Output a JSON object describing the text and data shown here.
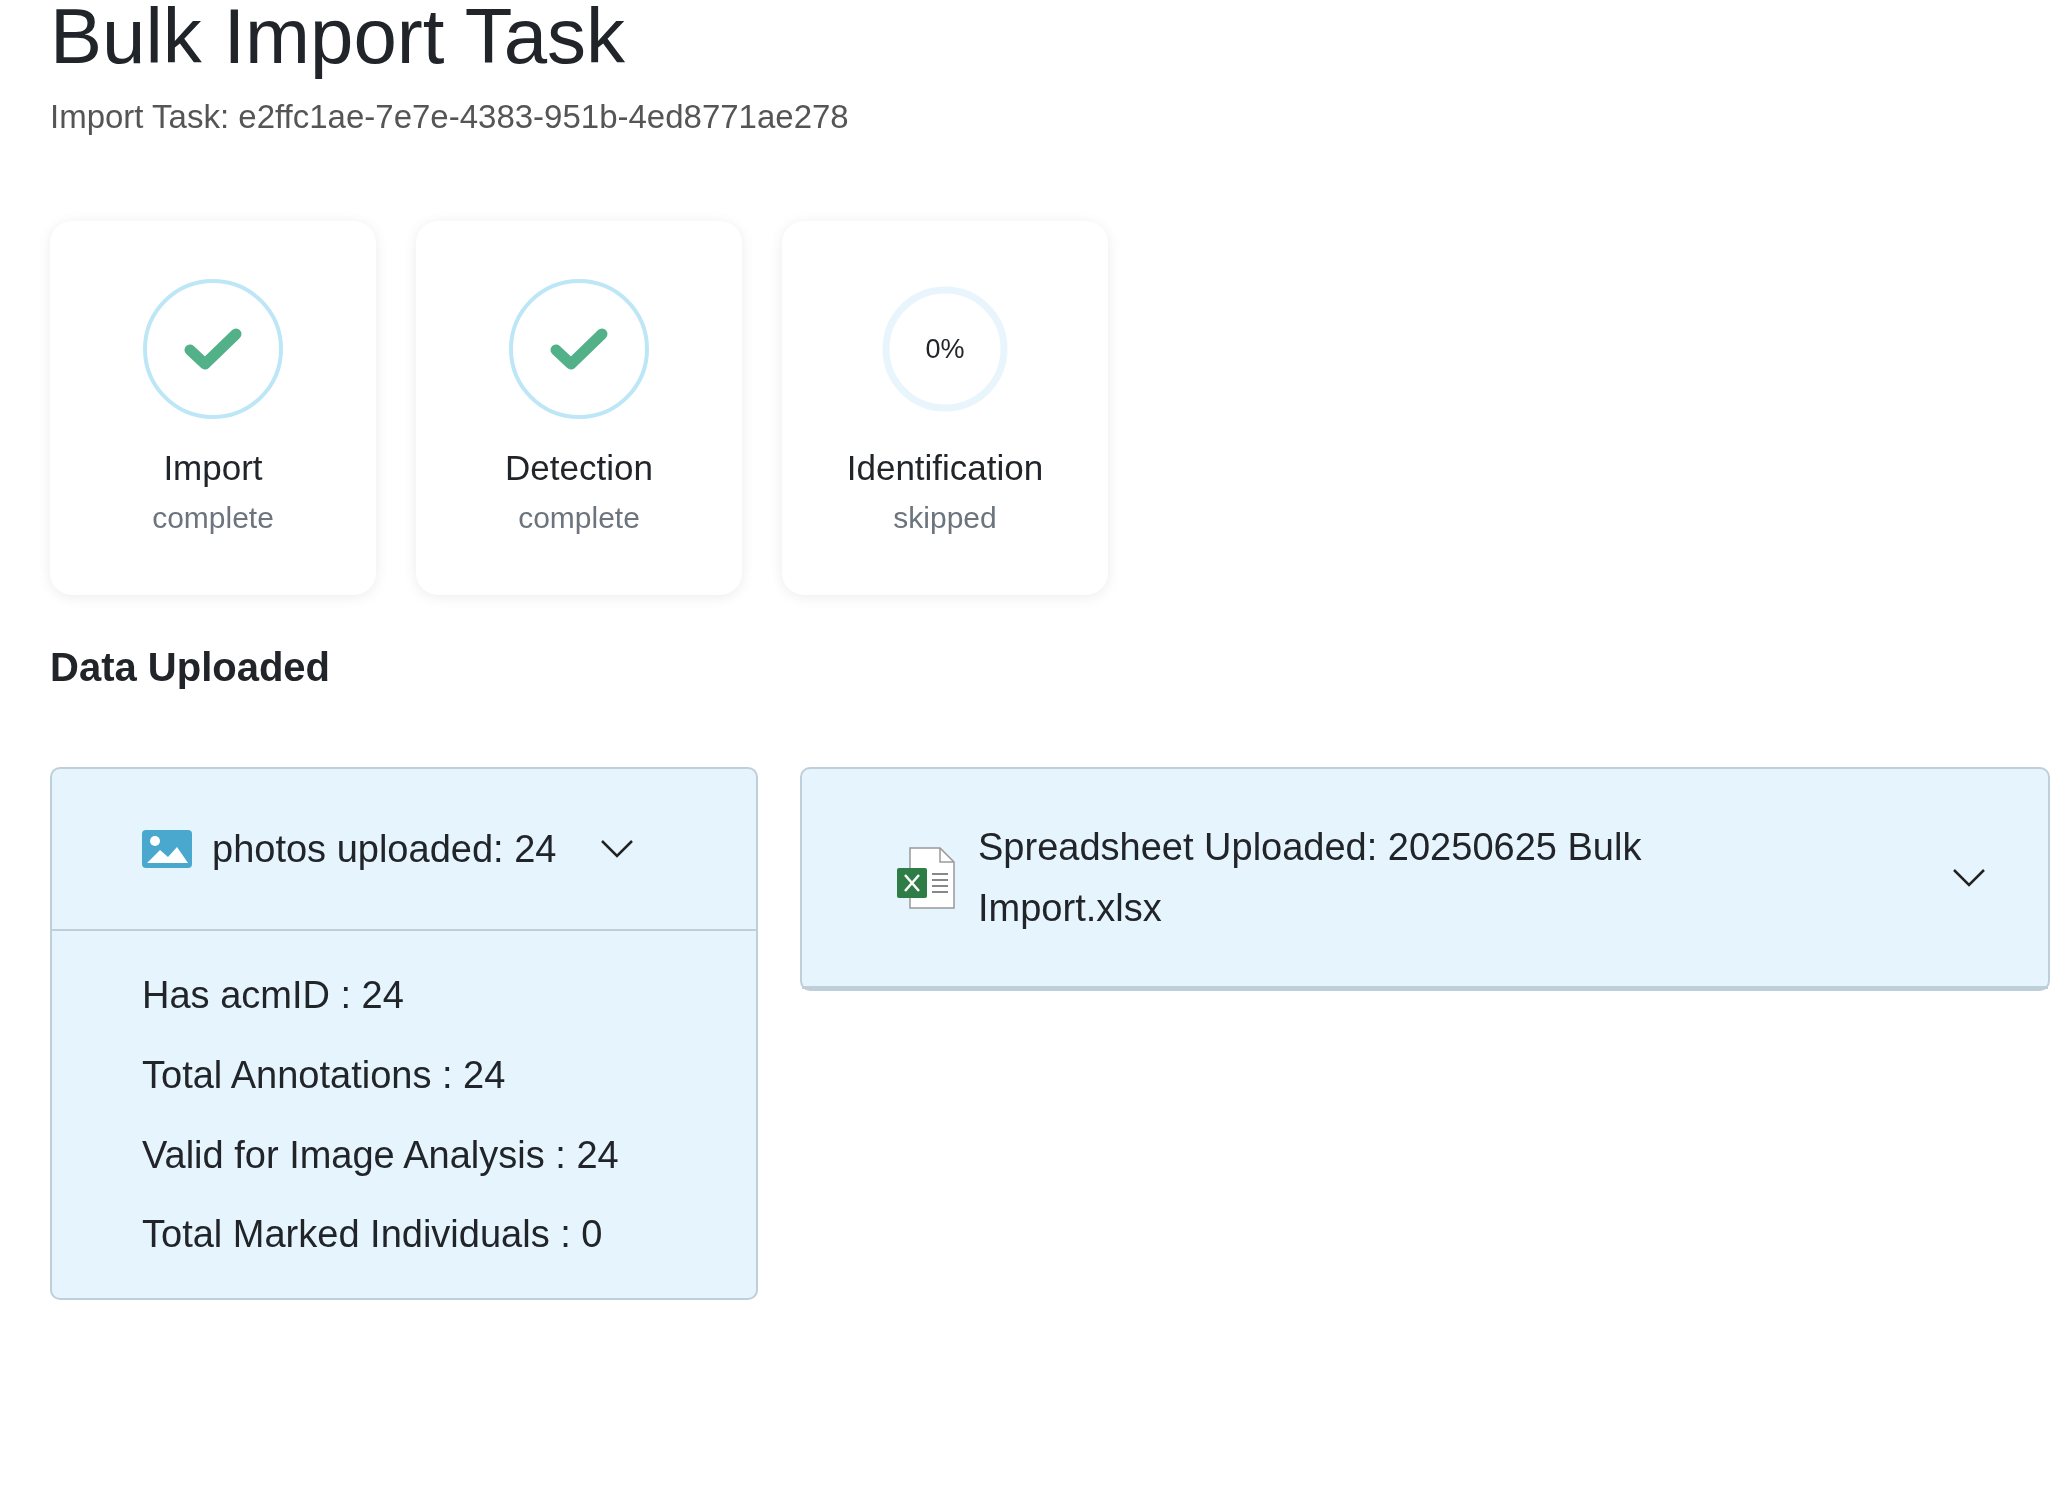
{
  "title": "Bulk Import Task",
  "subtitle": "Import Task: e2ffc1ae-7e7e-4383-951b-4ed8771ae278",
  "stages": [
    {
      "kind": "done",
      "label": "Import",
      "status": "complete"
    },
    {
      "kind": "done",
      "label": "Detection",
      "status": "complete"
    },
    {
      "kind": "progress",
      "percent": "0%",
      "label": "Identification",
      "status": "skipped"
    }
  ],
  "section_title": "Data Uploaded",
  "panels": [
    {
      "kind": "photos",
      "title": "photos uploaded: 24",
      "expanded": true,
      "items": [
        "Has acmID : 24",
        "Total Annotations : 24",
        "Valid for Image Analysis : 24",
        "Total Marked Individuals : 0"
      ]
    },
    {
      "kind": "spreadsheet",
      "title": "Spreadsheet Uploaded: 20250625 Bulk Import.xlsx",
      "expanded": false
    }
  ]
}
